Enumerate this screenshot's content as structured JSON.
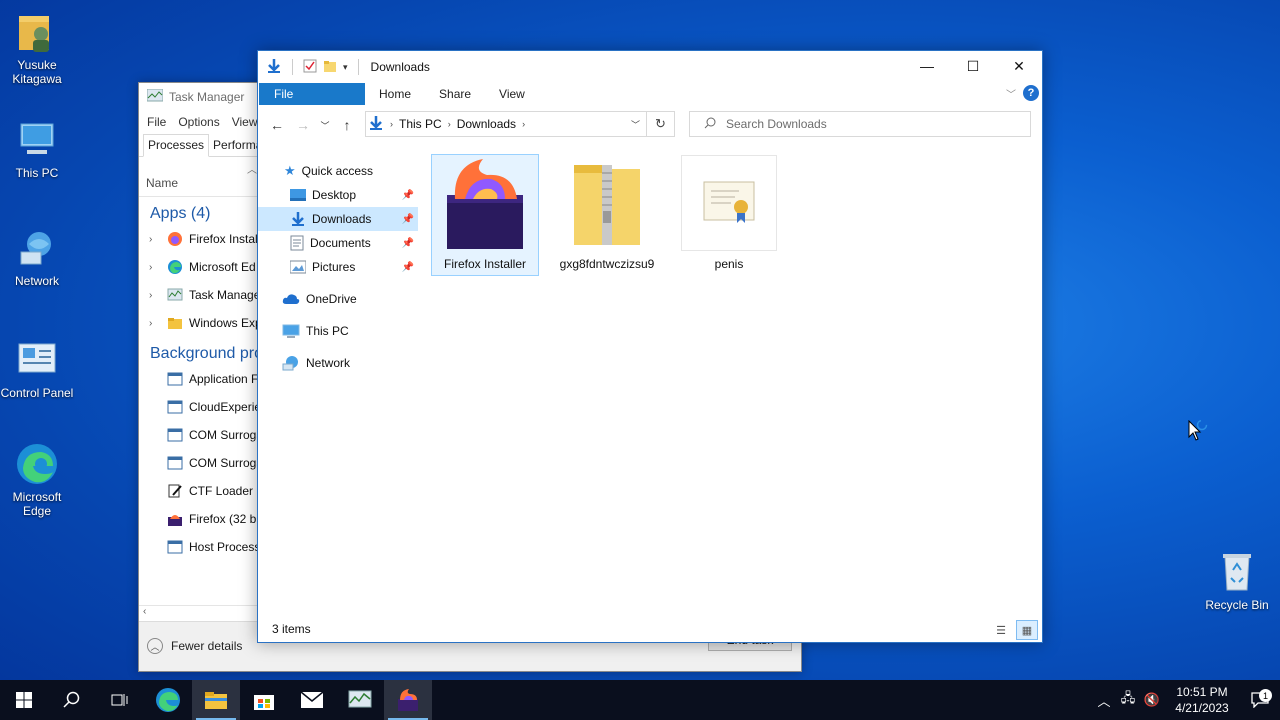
{
  "desktop": {
    "icons": [
      {
        "label": "Yusuke Kitagawa",
        "icon": "user-folder-icon"
      },
      {
        "label": "This PC",
        "icon": "computer-icon"
      },
      {
        "label": "Network",
        "icon": "network-icon"
      },
      {
        "label": "Control Panel",
        "icon": "control-panel-icon"
      },
      {
        "label": "Microsoft Edge",
        "icon": "edge-icon"
      },
      {
        "label": "Recycle Bin",
        "icon": "recycle-bin-icon"
      }
    ]
  },
  "task_manager": {
    "title": "Task Manager",
    "menu": [
      "File",
      "Options",
      "View"
    ],
    "tabs": [
      "Processes",
      "Performa"
    ],
    "column_name": "Name",
    "group_apps": "Apps (4)",
    "apps": [
      "Firefox Instal",
      "Microsoft Ed",
      "Task Manage",
      "Windows Exp"
    ],
    "group_background": "Background pro",
    "background": [
      "Application F",
      "CloudExperie",
      "COM Surroga",
      "COM Surroga",
      "CTF Loader",
      "Firefox (32 bi",
      "Host Process"
    ],
    "fewer_details": "Fewer details",
    "end_task": "End task"
  },
  "explorer": {
    "title": "Downloads",
    "ribbon_tabs": [
      "File",
      "Home",
      "Share",
      "View"
    ],
    "breadcrumb": [
      "This PC",
      "Downloads"
    ],
    "search_placeholder": "Search Downloads",
    "nav": {
      "quick_access": "Quick access",
      "pinned": [
        "Desktop",
        "Downloads",
        "Documents",
        "Pictures"
      ],
      "onedrive": "OneDrive",
      "this_pc": "This PC",
      "network": "Network"
    },
    "files": [
      {
        "name": "Firefox Installer",
        "type": "installer"
      },
      {
        "name": "gxg8fdntwczizsu9",
        "type": "zip"
      },
      {
        "name": "penis",
        "type": "certificate"
      }
    ],
    "status": "3 items"
  },
  "taskbar": {
    "time": "10:51 PM",
    "date": "4/21/2023",
    "notification_count": "1"
  },
  "colors": {
    "accent": "#1979ca",
    "selection": "#cce8ff",
    "taskbar": "#0a0f1e"
  }
}
